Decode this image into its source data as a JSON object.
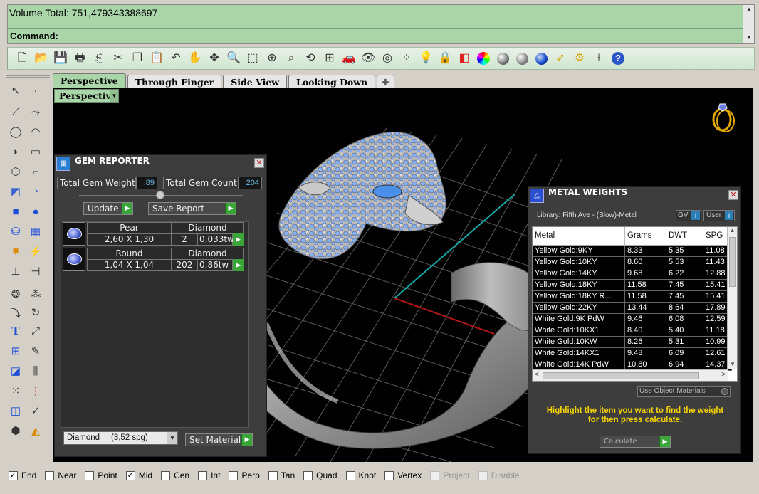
{
  "command": {
    "history": "Volume Total: 751,479343388697",
    "prompt_label": "Command:"
  },
  "toolbar_icons": [
    "new-file-icon",
    "open-folder-icon",
    "save-icon",
    "print-icon",
    "import-icon",
    "cut-icon",
    "copy-icon",
    "paste-icon",
    "undo-icon",
    "pan-hand-icon",
    "rotate-view-icon",
    "zoom-dynamic-icon",
    "zoom-window-icon",
    "zoom-extents-icon",
    "zoom-selected-icon",
    "undo-view-icon",
    "four-viewports-icon",
    "car-icon",
    "eye-icon",
    "target-icon",
    "snap-points-icon",
    "light-bulb-icon",
    "lock-icon",
    "layers-icon",
    "color-wheel-icon",
    "render-sphere-icon",
    "rendered-sphere-icon",
    "blue-sphere-icon",
    "cursor-pick-icon",
    "gear-icon",
    "dimension-icon",
    "help-icon"
  ],
  "viewport_tabs": [
    "Perspective",
    "Through Finger",
    "Side View",
    "Looking Down"
  ],
  "viewport_label": "Perspective",
  "gem_reporter": {
    "title": "GEM REPORTER",
    "total_weight_label": "Total Gem Weight",
    "total_weight_value": ",89",
    "total_count_label": "Total Gem Count",
    "total_count_value": "204",
    "update_label": "Update",
    "save_report_label": "Save Report",
    "gems": [
      {
        "shape": "Pear",
        "material": "Diamond",
        "size": "2,60 X 1,30",
        "count": "2",
        "weight": "0,033tw"
      },
      {
        "shape": "Round",
        "material": "Diamond",
        "size": "1,04 X 1,04",
        "count": "202",
        "weight": "0,86tw"
      }
    ],
    "material_select": "Diamond     (3,52 spg)",
    "set_material_label": "Set Material"
  },
  "metal_weights": {
    "title": "METAL WEIGHTS",
    "library": "Library: Fifth Ave - (Slow)-Metal",
    "gv_label": "GV",
    "user_label": "User",
    "columns": [
      "Metal",
      "Grams",
      "DWT",
      "SPG"
    ],
    "rows": [
      [
        "Yellow Gold:9KY",
        "8.33",
        "5.35",
        "11.08"
      ],
      [
        "Yellow Gold:10KY",
        "8.60",
        "5.53",
        "11.43"
      ],
      [
        "Yellow Gold:14KY",
        "9.68",
        "6.22",
        "12.88"
      ],
      [
        "Yellow Gold:18KY",
        "11.58",
        "7.45",
        "15.41"
      ],
      [
        "Yellow Gold:18KY R...",
        "11.58",
        "7.45",
        "15.41"
      ],
      [
        "Yellow Gold:22KY",
        "13.44",
        "8.64",
        "17.89"
      ],
      [
        "White Gold:9K PdW",
        "9.46",
        "6.08",
        "12.59"
      ],
      [
        "White Gold:10KX1",
        "8.40",
        "5.40",
        "11.18"
      ],
      [
        "White Gold:10KW",
        "8.26",
        "5.31",
        "10.99"
      ],
      [
        "White Gold:14KX1",
        "9.48",
        "6.09",
        "12.61"
      ],
      [
        "White Gold:14K PdW",
        "10.80",
        "6.94",
        "14.37"
      ]
    ],
    "use_object_materials": "Use Object Materials",
    "instruction": "Highlight the item you want to find the weight for then press calculate.",
    "calculate_label": "Calculate"
  },
  "osnaps": [
    {
      "label": "End",
      "checked": true
    },
    {
      "label": "Near",
      "checked": false
    },
    {
      "label": "Point",
      "checked": false
    },
    {
      "label": "Mid",
      "checked": true
    },
    {
      "label": "Cen",
      "checked": false
    },
    {
      "label": "Int",
      "checked": false
    },
    {
      "label": "Perp",
      "checked": false
    },
    {
      "label": "Tan",
      "checked": false
    },
    {
      "label": "Quad",
      "checked": false
    },
    {
      "label": "Knot",
      "checked": false
    },
    {
      "label": "Vertex",
      "checked": false
    },
    {
      "label": "Project",
      "checked": false,
      "disabled": true
    },
    {
      "label": "Disable",
      "checked": false,
      "disabled": true
    }
  ],
  "colors": {
    "command_bg": "#a9d5a9",
    "panel_bg": "#3d3d3d",
    "accent_green": "#3aa63a",
    "instruction_text": "#f5d400",
    "gem_blue": "#7aa8f0"
  }
}
